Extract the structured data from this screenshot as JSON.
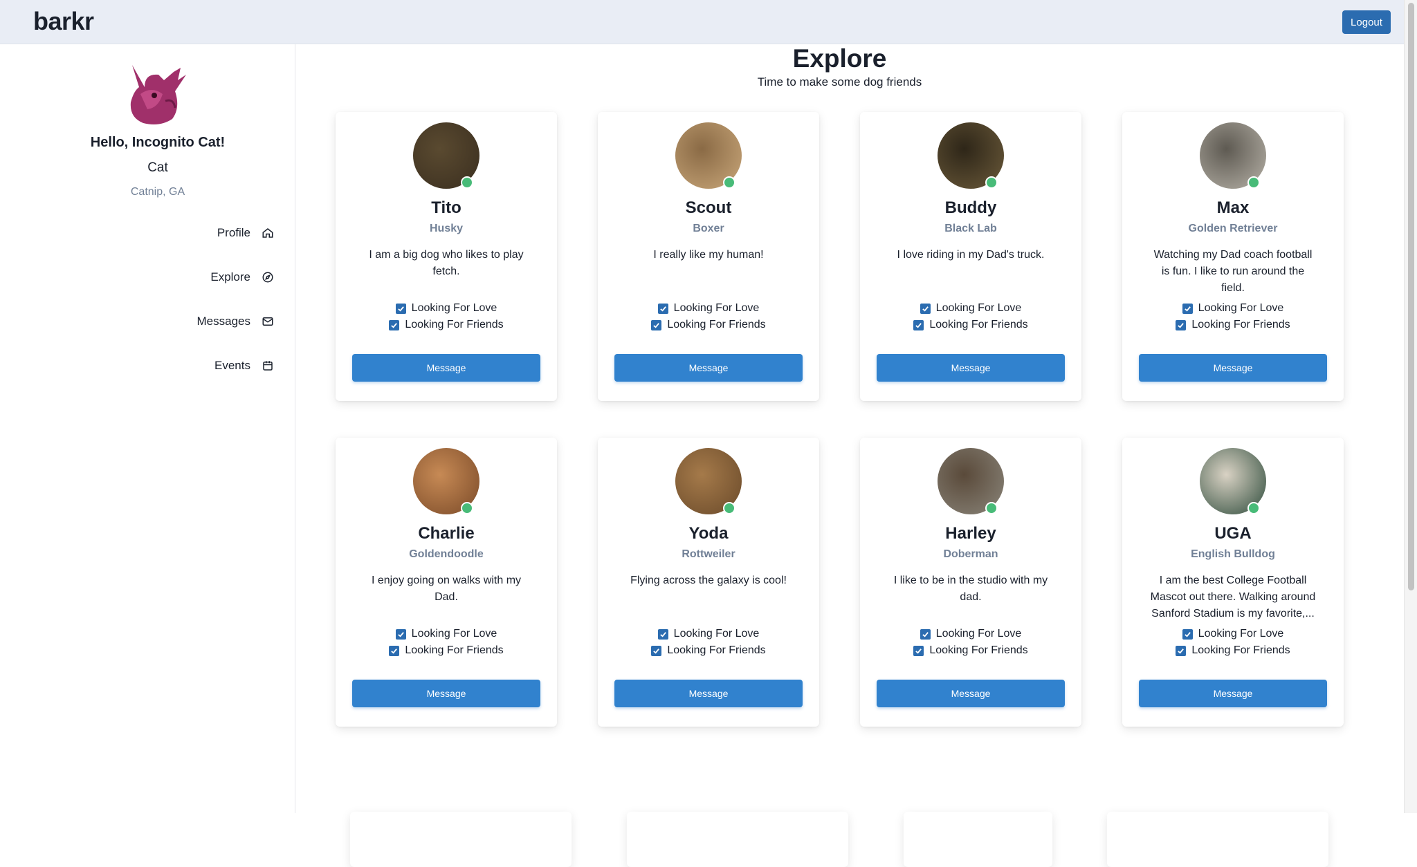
{
  "app": {
    "logo": "barkr",
    "logout_label": "Logout"
  },
  "sidebar": {
    "greeting": "Hello, Incognito Cat!",
    "species": "Cat",
    "location": "Catnip, GA",
    "nav": [
      {
        "label": "Profile",
        "icon": "home-icon"
      },
      {
        "label": "Explore",
        "icon": "compass-icon"
      },
      {
        "label": "Messages",
        "icon": "mail-icon"
      },
      {
        "label": "Events",
        "icon": "calendar-icon"
      }
    ]
  },
  "main": {
    "title": "Explore",
    "subtitle": "Time to make some dog friends"
  },
  "checkbox_labels": {
    "love": "Looking For Love",
    "friends": "Looking For Friends"
  },
  "message_label": "Message",
  "dogs": [
    {
      "name": "Tito",
      "breed": "Husky",
      "bio": "I am a big dog who likes to play fetch."
    },
    {
      "name": "Scout",
      "breed": "Boxer",
      "bio": "I really like my human!"
    },
    {
      "name": "Buddy",
      "breed": "Black Lab",
      "bio": "I love riding in my Dad's truck."
    },
    {
      "name": "Max",
      "breed": "Golden Retriever",
      "bio": "Watching my Dad coach football is fun. I like to run around the field."
    },
    {
      "name": "Charlie",
      "breed": "Goldendoodle",
      "bio": "I enjoy going on walks with my Dad."
    },
    {
      "name": "Yoda",
      "breed": "Rottweiler",
      "bio": "Flying across the galaxy is cool!"
    },
    {
      "name": "Harley",
      "breed": "Doberman",
      "bio": "I like to be in the studio with my dad."
    },
    {
      "name": "UGA",
      "breed": "English Bulldog",
      "bio": "I am the best College Football Mascot out there. Walking around Sanford Stadium is my favorite,..."
    }
  ],
  "colors": {
    "accent": "#3182ce",
    "online": "#48bb78",
    "topbar": "#e9edf5"
  }
}
